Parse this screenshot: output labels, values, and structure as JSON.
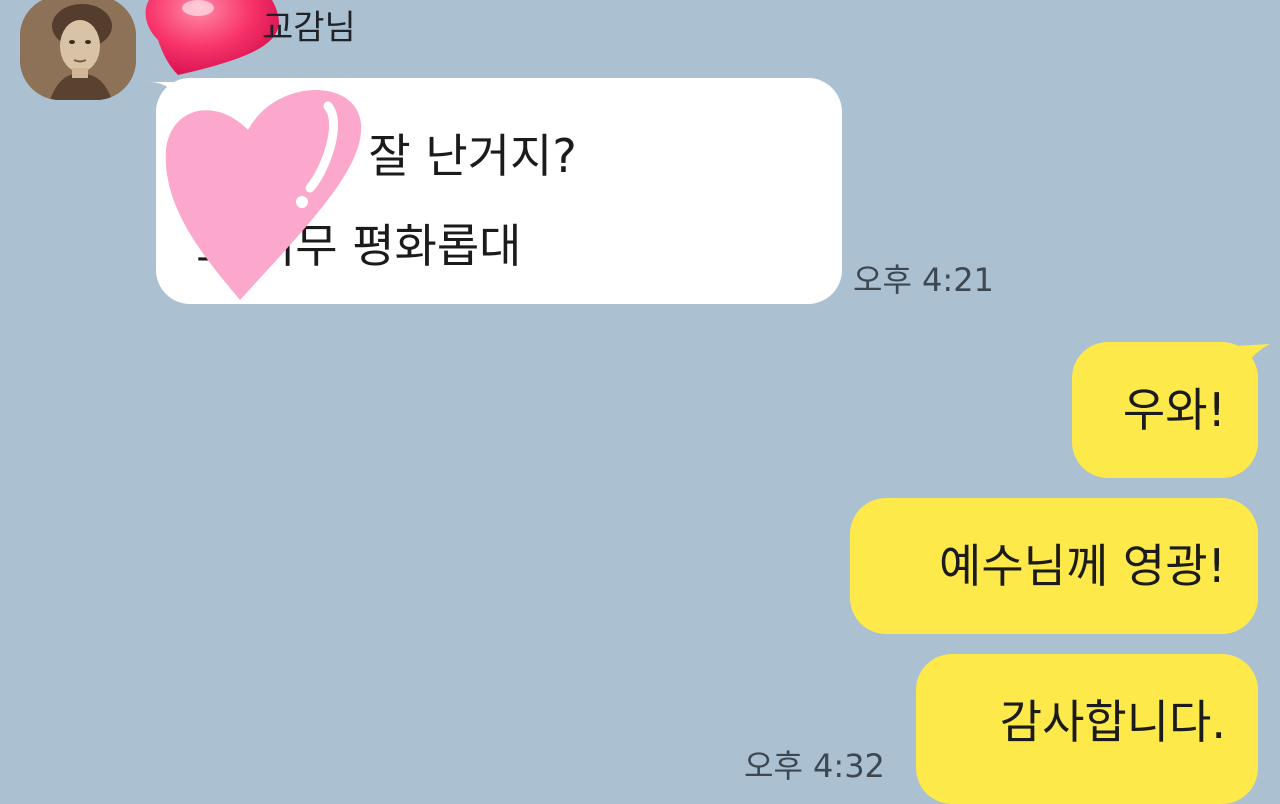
{
  "chat": {
    "sender": {
      "name": "교감님"
    },
    "incoming": {
      "line1": "~ 너무 잘 난거지?",
      "line2": "초 너무 평화롭대",
      "time": "오후 4:21"
    },
    "outgoing": {
      "messages": [
        {
          "text": "우와!"
        },
        {
          "text": "예수님께 영광!"
        },
        {
          "text": "감사합니다."
        }
      ],
      "time": "오후 4:32"
    }
  },
  "stickers": {
    "red_heart": "heart-icon",
    "pink_heart": "heart-icon"
  },
  "colors": {
    "background": "#abc1d1",
    "incoming_bubble": "#ffffff",
    "outgoing_bubble": "#fde94a",
    "time_text": "#3d4750"
  }
}
